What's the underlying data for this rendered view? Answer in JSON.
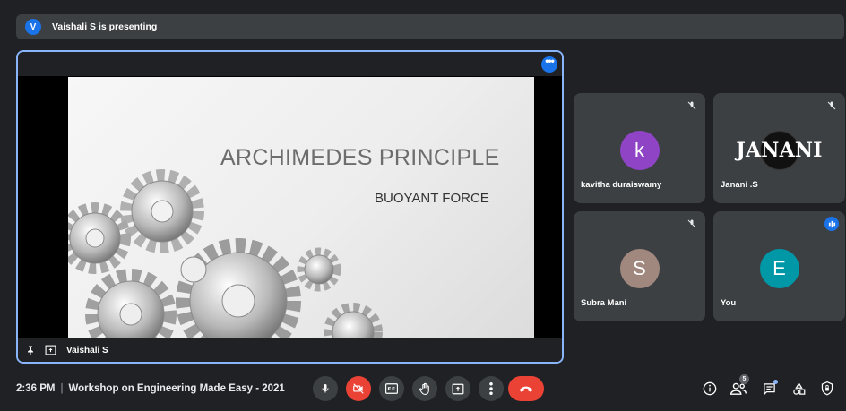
{
  "banner": {
    "avatar_letter": "V",
    "text": "Vaishali S is presenting"
  },
  "presentation": {
    "slide_title": "ARCHIMEDES PRINCIPLE",
    "slide_subtitle": "BUOYANT FORCE",
    "presenter_name": "Vaishali S"
  },
  "participants": [
    {
      "name": "kavitha duraiswamy",
      "initial": "k",
      "color": "#8e44c5",
      "muted": true
    },
    {
      "name": "Janani .S",
      "initial": "JANANI",
      "color": "#111111",
      "muted": true
    },
    {
      "name": "Subra Mani",
      "initial": "S",
      "color": "#a1887f",
      "muted": true
    },
    {
      "name": "You",
      "initial": "E",
      "color": "#0097a7",
      "muted": false,
      "speaking": true
    }
  ],
  "bottom_bar": {
    "time": "2:36 PM",
    "separator": "|",
    "meeting_title": "Workshop on Engineering Made Easy - 2021",
    "people_count": "5"
  },
  "colors": {
    "accent": "#8ab4f8",
    "danger": "#ea4335",
    "tile_bg": "#3c4043",
    "page_bg": "#202124"
  }
}
